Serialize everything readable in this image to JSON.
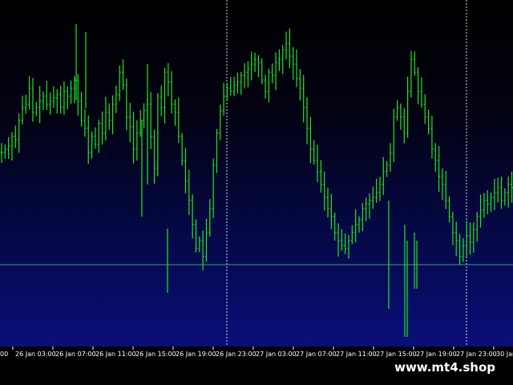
{
  "colors": {
    "candle": "#1ee81e",
    "grid": "#ffffff",
    "hline": "#3c9c78",
    "axis_text": "#ffffff"
  },
  "chart_data": {
    "type": "candlestick",
    "x_tick_labels": [
      "26 Jan 03:00",
      "26 Jan 07:00",
      "26 Jan 11:00",
      "26 Jan 15:00",
      "26 Jan 19:00",
      "26 Jan 23:00",
      "27 Jan 03:00",
      "27 Jan 07:00",
      "27 Jan 11:00",
      "27 Jan 15:00",
      "27 Jan 19:00",
      "27 Jan 23:00",
      "30 Jan"
    ],
    "first_partial_label": "00",
    "period_separators": [
      "26 Jan 23:00",
      "27 Jan 23:00"
    ],
    "horizontal_line": "at the level of the 26 Jan 17:00 lows",
    "closes": [
      60,
      62,
      64,
      70,
      68,
      80,
      88,
      90,
      100,
      85,
      88,
      92,
      95,
      90,
      92,
      94,
      96,
      88,
      98,
      95,
      100,
      105,
      92,
      80,
      75,
      60,
      70,
      65,
      78,
      72,
      85,
      80,
      90,
      96,
      110,
      102,
      82,
      76,
      62,
      72,
      80,
      86,
      90,
      70,
      50,
      95,
      88,
      110,
      104,
      90,
      85,
      70,
      55,
      42,
      30,
      15,
      0,
      5,
      -5,
      10,
      25,
      52,
      72,
      86,
      95,
      100,
      98,
      102,
      104,
      108,
      110,
      112,
      115,
      118,
      116,
      105,
      98,
      110,
      108,
      116,
      118,
      124,
      128,
      120,
      115,
      106,
      100,
      88,
      75,
      62,
      55,
      48,
      40,
      32,
      25,
      20,
      10,
      5,
      2,
      0,
      5,
      10,
      15,
      18,
      25,
      28,
      30,
      32,
      35,
      40,
      48,
      52,
      60,
      82,
      88,
      82,
      72,
      98,
      118,
      110,
      98,
      90,
      82,
      75,
      62,
      55,
      45,
      40,
      30,
      20,
      10,
      5,
      -5,
      2,
      8,
      4,
      12,
      20,
      24,
      30,
      28,
      32,
      35,
      38,
      30,
      35,
      40,
      38
    ],
    "lows_extremes": [
      50,
      55,
      -10,
      48,
      -15,
      40,
      -8,
      35,
      -35,
      -30,
      -65,
      25,
      0,
      12,
      22,
      26
    ]
  },
  "watermark": "www.mt4.shop"
}
